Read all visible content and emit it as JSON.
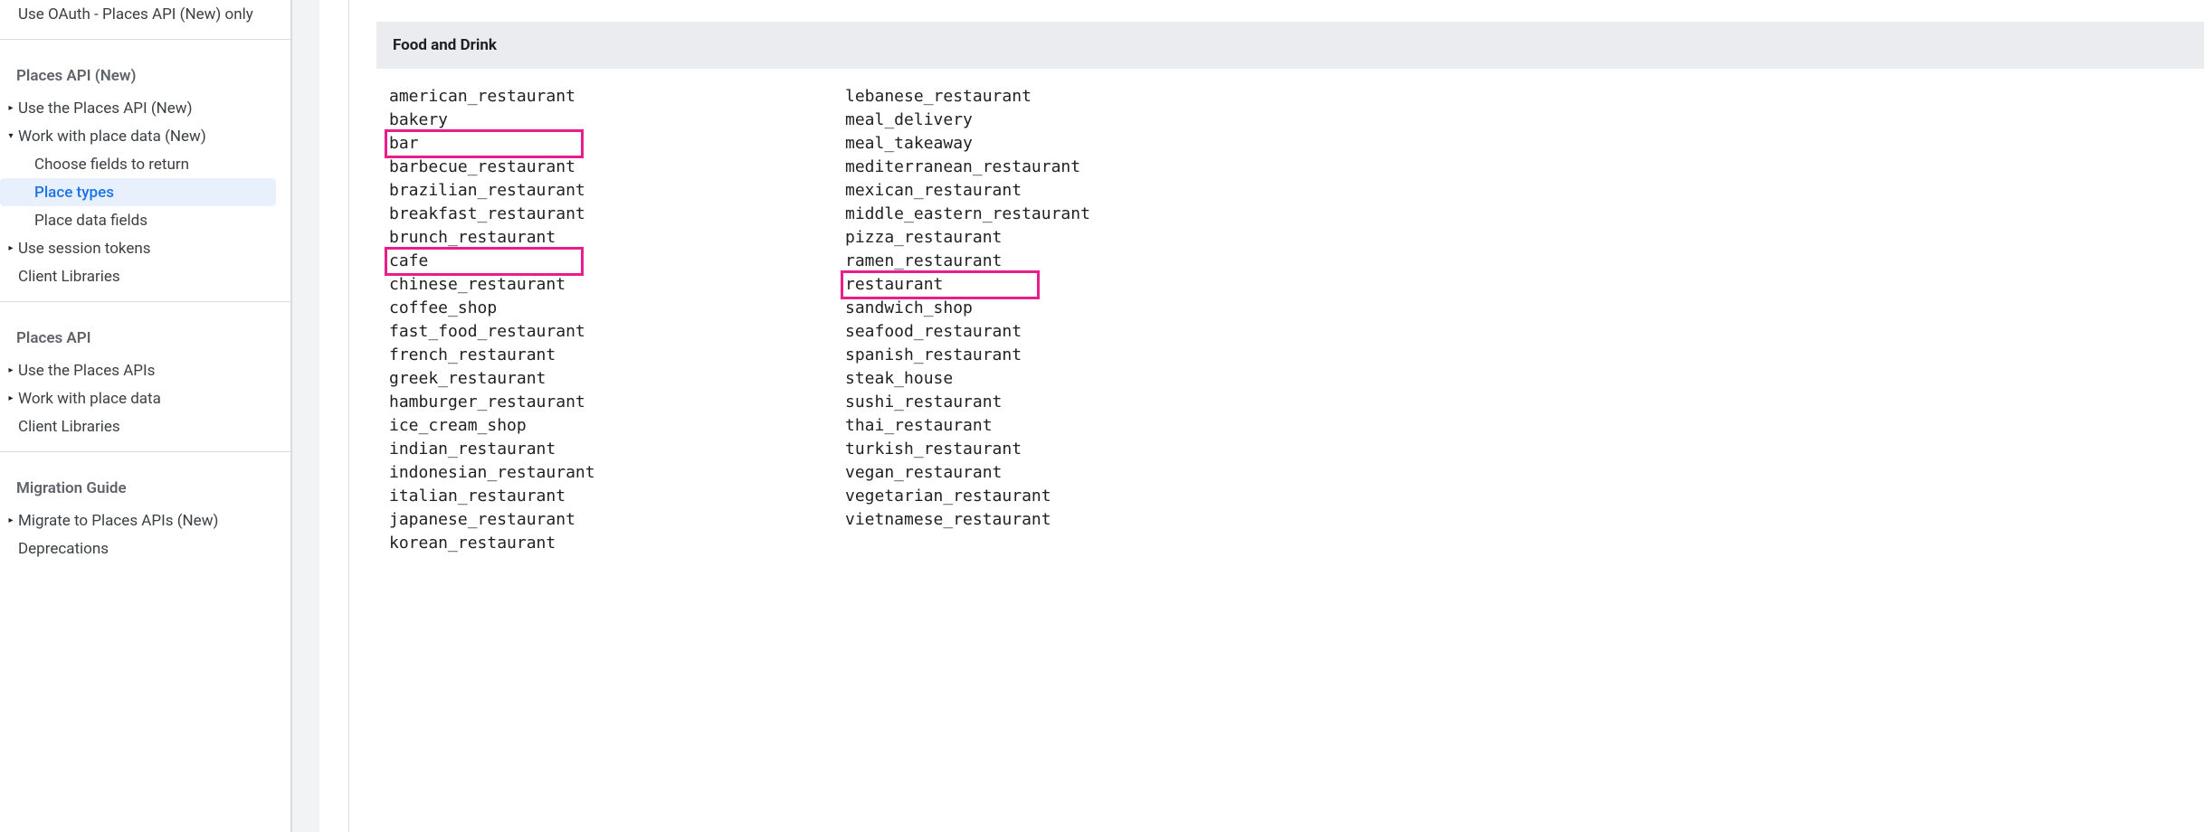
{
  "sidebar": {
    "top_item": "Use OAuth - Places API (New) only",
    "section1": {
      "title": "Places API (New)",
      "items": [
        {
          "label": "Use the Places API (New)",
          "arrow": "right"
        },
        {
          "label": "Work with place data (New)",
          "arrow": "down",
          "children": [
            {
              "label": "Choose fields to return"
            },
            {
              "label": "Place types",
              "active": true
            },
            {
              "label": "Place data fields"
            }
          ]
        },
        {
          "label": "Use session tokens",
          "arrow": "right"
        },
        {
          "label": "Client Libraries"
        }
      ]
    },
    "section2": {
      "title": "Places API",
      "items": [
        {
          "label": "Use the Places APIs",
          "arrow": "right"
        },
        {
          "label": "Work with place data",
          "arrow": "right"
        },
        {
          "label": "Client Libraries"
        }
      ]
    },
    "section3": {
      "title": "Migration Guide",
      "items": [
        {
          "label": "Migrate to Places APIs (New)",
          "arrow": "right"
        },
        {
          "label": "Deprecations"
        }
      ]
    }
  },
  "content": {
    "category_title": "Food and Drink",
    "col_left": [
      {
        "v": "american_restaurant"
      },
      {
        "v": "bakery"
      },
      {
        "v": "bar",
        "highlight": true
      },
      {
        "v": "barbecue_restaurant"
      },
      {
        "v": "brazilian_restaurant"
      },
      {
        "v": "breakfast_restaurant"
      },
      {
        "v": "brunch_restaurant"
      },
      {
        "v": "cafe",
        "highlight": true
      },
      {
        "v": "chinese_restaurant"
      },
      {
        "v": "coffee_shop"
      },
      {
        "v": "fast_food_restaurant"
      },
      {
        "v": "french_restaurant"
      },
      {
        "v": "greek_restaurant"
      },
      {
        "v": "hamburger_restaurant"
      },
      {
        "v": "ice_cream_shop"
      },
      {
        "v": "indian_restaurant"
      },
      {
        "v": "indonesian_restaurant"
      },
      {
        "v": "italian_restaurant"
      },
      {
        "v": "japanese_restaurant"
      },
      {
        "v": "korean_restaurant"
      }
    ],
    "col_right": [
      {
        "v": "lebanese_restaurant"
      },
      {
        "v": "meal_delivery"
      },
      {
        "v": "meal_takeaway"
      },
      {
        "v": "mediterranean_restaurant"
      },
      {
        "v": "mexican_restaurant"
      },
      {
        "v": "middle_eastern_restaurant"
      },
      {
        "v": "pizza_restaurant"
      },
      {
        "v": "ramen_restaurant"
      },
      {
        "v": "restaurant",
        "highlight": true
      },
      {
        "v": "sandwich_shop"
      },
      {
        "v": "seafood_restaurant"
      },
      {
        "v": "spanish_restaurant"
      },
      {
        "v": "steak_house"
      },
      {
        "v": "sushi_restaurant"
      },
      {
        "v": "thai_restaurant"
      },
      {
        "v": "turkish_restaurant"
      },
      {
        "v": "vegan_restaurant"
      },
      {
        "v": "vegetarian_restaurant"
      },
      {
        "v": "vietnamese_restaurant"
      }
    ]
  }
}
